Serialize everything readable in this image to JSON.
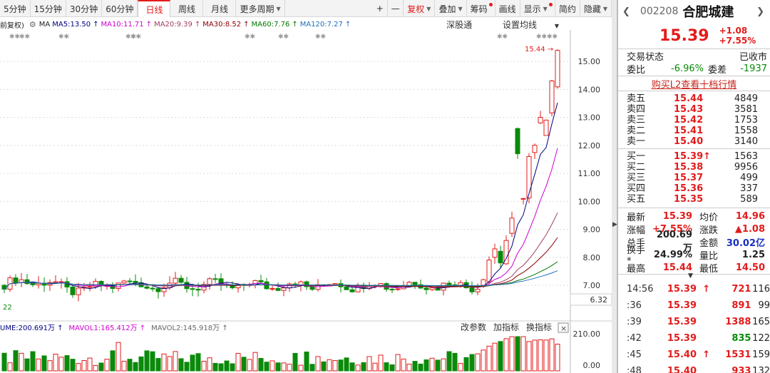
{
  "toolbar": {
    "periods": [
      "5分钟",
      "15分钟",
      "30分钟",
      "60分钟",
      "日线",
      "周线",
      "月线",
      "更多周期"
    ],
    "active": "日线",
    "tools": [
      "+",
      "—",
      "复权",
      "叠加",
      "筹码",
      "画线",
      "显示",
      "简约",
      "隐藏"
    ]
  },
  "ma_bar": {
    "prefix": "前复权)",
    "ma": "MA",
    "ma5": "MA5:13.50",
    "ma10": "MA10:11.71",
    "ma20": "MA20:9.39",
    "ma30": "MA30:8.52",
    "ma60": "MA60:7.76",
    "ma120": "MA120:7.27",
    "shengutong": "深股通",
    "setting": "设置均线"
  },
  "chart": {
    "high_label": "15.44",
    "low_label": "22",
    "current_price_box": "6.32",
    "y_ticks": [
      "15.00",
      "14.00",
      "13.00",
      "12.00",
      "11.00",
      "10.00",
      "9.00",
      "8.00",
      "7.00"
    ],
    "vol_ticks": [
      "210.00",
      "0.00"
    ]
  },
  "volume_bar": {
    "ume": "UME:200.691万",
    "mavol1": "MAVOL1:165.412万",
    "mavol2": "MAVOL2:145.918万",
    "btn_params": "改参数",
    "btn_add": "加指标",
    "btn_swap": "换指标"
  },
  "colors": {
    "up": "#e31b1b",
    "down": "#0a8a0a",
    "ma5": "#000080",
    "ma10": "#d000d0",
    "ma20": "#a04060",
    "ma30": "#8b0000",
    "ma60": "#007700",
    "ma120": "#1f6fbf"
  },
  "stock": {
    "code": "002208",
    "name": "合肥城建",
    "price": "15.39",
    "change": "+1.08",
    "pct": "+7.55%"
  },
  "status": {
    "label": "交易状态",
    "value": "已收市"
  },
  "ratio": {
    "wb_label": "委比",
    "wb": "-6.96%",
    "wc_label": "委差",
    "wc": "-1937"
  },
  "l2": "购买L2查看十档行情",
  "asks": [
    {
      "l": "卖五",
      "p": "15.44",
      "v": "4849"
    },
    {
      "l": "卖四",
      "p": "15.43",
      "v": "3581"
    },
    {
      "l": "卖三",
      "p": "15.42",
      "v": "1753"
    },
    {
      "l": "卖二",
      "p": "15.41",
      "v": "1558"
    },
    {
      "l": "卖一",
      "p": "15.40",
      "v": "3140"
    }
  ],
  "bids": [
    {
      "l": "买一",
      "p": "15.39",
      "a": "↑",
      "v": "1563"
    },
    {
      "l": "买二",
      "p": "15.38",
      "a": "",
      "v": "9956"
    },
    {
      "l": "买三",
      "p": "15.37",
      "a": "",
      "v": "499"
    },
    {
      "l": "买四",
      "p": "15.36",
      "a": "",
      "v": "337"
    },
    {
      "l": "买五",
      "p": "15.35",
      "a": "",
      "v": "589"
    }
  ],
  "quote": [
    {
      "k1": "最新",
      "v1": "15.39",
      "c1": "red",
      "k2": "均价",
      "v2": "14.96",
      "c2": "red"
    },
    {
      "k1": "涨幅",
      "v1": "+7.55%",
      "c1": "red",
      "k2": "涨跌",
      "v2": "▲1.08",
      "c2": "red"
    },
    {
      "k1": "总手",
      "v1": "200.69万",
      "c1": "",
      "k2": "金额",
      "v2": "30.02亿",
      "c2": "blue"
    },
    {
      "k1": "换手*",
      "v1": "24.99%",
      "c1": "",
      "k2": "量比",
      "v2": "1.25",
      "c2": ""
    },
    {
      "k1": "最高",
      "v1": "15.44",
      "c1": "red",
      "k2": "最低",
      "v2": "14.50",
      "c2": "red"
    }
  ],
  "ticks": [
    {
      "t": "14:56",
      "p": "15.39",
      "a": "↑",
      "v": "721",
      "c": "red",
      "n": "116"
    },
    {
      "t": ":36",
      "p": "15.39",
      "a": "",
      "v": "891",
      "c": "red",
      "n": "99"
    },
    {
      "t": ":39",
      "p": "15.39",
      "a": "",
      "v": "1388",
      "c": "red",
      "n": "165"
    },
    {
      "t": ":42",
      "p": "15.39",
      "a": "",
      "v": "835",
      "c": "green",
      "n": "122"
    },
    {
      "t": ":45",
      "p": "15.40",
      "a": "↑",
      "v": "1531",
      "c": "red",
      "n": "159"
    },
    {
      "t": ":48",
      "p": "15.40",
      "a": "",
      "v": "933",
      "c": "red",
      "n": "132"
    }
  ]
}
